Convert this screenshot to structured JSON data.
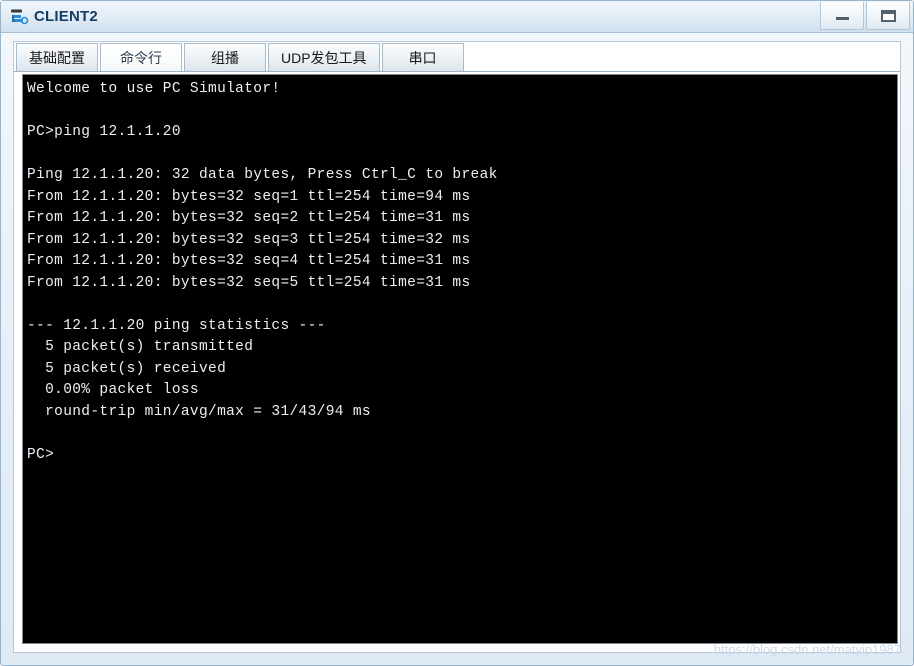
{
  "window": {
    "title": "CLIENT2",
    "icon": "pc-simulator-icon",
    "minimize_label": "–",
    "maximize_label": "□"
  },
  "tabs": [
    {
      "label": "基础配置",
      "name": "tab-basic-config",
      "selected": false
    },
    {
      "label": "命令行",
      "name": "tab-command-line",
      "selected": true
    },
    {
      "label": "组播",
      "name": "tab-multicast",
      "selected": false
    },
    {
      "label": "UDP发包工具",
      "name": "tab-udp-tool",
      "selected": false
    },
    {
      "label": "串口",
      "name": "tab-serial-port",
      "selected": false
    }
  ],
  "terminal": {
    "background_color": "#000000",
    "text_color": "#eceff2",
    "lines": [
      "Welcome to use PC Simulator!",
      "",
      "PC>ping 12.1.1.20",
      "",
      "Ping 12.1.1.20: 32 data bytes, Press Ctrl_C to break",
      "From 12.1.1.20: bytes=32 seq=1 ttl=254 time=94 ms",
      "From 12.1.1.20: bytes=32 seq=2 ttl=254 time=31 ms",
      "From 12.1.1.20: bytes=32 seq=3 ttl=254 time=32 ms",
      "From 12.1.1.20: bytes=32 seq=4 ttl=254 time=31 ms",
      "From 12.1.1.20: bytes=32 seq=5 ttl=254 time=31 ms",
      "",
      "--- 12.1.1.20 ping statistics ---",
      "  5 packet(s) transmitted",
      "  5 packet(s) received",
      "  0.00% packet loss",
      "  round-trip min/avg/max = 31/43/94 ms",
      "",
      "PC>"
    ]
  },
  "watermark": {
    "text": "https://blog.csdn.net/matyip1987"
  }
}
